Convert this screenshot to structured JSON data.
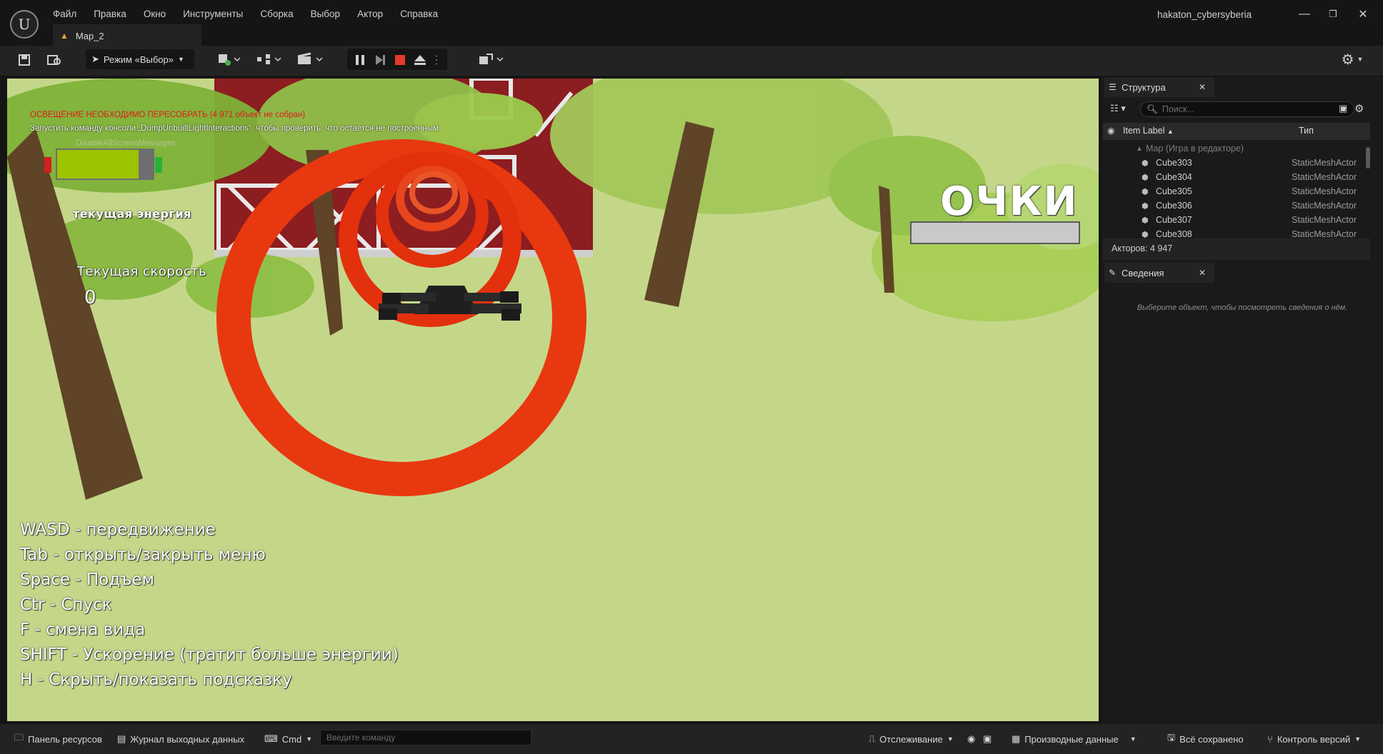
{
  "app": {
    "project_name": "hakaton_cybersyberia",
    "document_tab": "Map_2"
  },
  "menu": [
    "Файл",
    "Правка",
    "Окно",
    "Инструменты",
    "Сборка",
    "Выбор",
    "Актор",
    "Справка"
  ],
  "toolbar": {
    "mode_label": "Режим «Выбор»"
  },
  "viewport": {
    "warning_title": "ОСВЕЩЕНИЕ НЕОБХОДИМО ПЕРЕСОБРАТЬ (4 971 объект не собран)",
    "warning_hint": "Запустить команду консоли „DumpUnbuiltLightInteractions“, чтобы проверить, что остается не построенным",
    "screen_message": "DisableAllScreenMessages",
    "energy_label": "текущая энергия",
    "energy_level": 0.85,
    "speed_label": "Текущая скорость",
    "speed_value": "0",
    "score_label": "ОЧКИ",
    "hints": [
      "WASD - передвижение",
      "Tab - открыть/закрыть меню",
      "Space - Подъем",
      "Ctr - Спуск",
      "F - смена вида",
      "SHIFT - Ускорение (тратит больше энергии)",
      "H - Скрыть/показать подсказку"
    ]
  },
  "outliner": {
    "tab_label": "Структура",
    "search_placeholder": "Поиск...",
    "col_label": "Item Label",
    "col_type": "Тип",
    "map_row": "Map (Игра в редакторе)",
    "rows": [
      {
        "name": "Cube303",
        "type": "StaticMeshActor"
      },
      {
        "name": "Cube304",
        "type": "StaticMeshActor"
      },
      {
        "name": "Cube305",
        "type": "StaticMeshActor"
      },
      {
        "name": "Cube306",
        "type": "StaticMeshActor"
      },
      {
        "name": "Cube307",
        "type": "StaticMeshActor"
      },
      {
        "name": "Cube308",
        "type": "StaticMeshActor"
      }
    ],
    "actor_count": "Акторов: 4 947"
  },
  "details": {
    "tab_label": "Сведения",
    "empty_hint": "Выберите объект, чтобы посмотреть сведения о нём."
  },
  "statusbar": {
    "content_browser": "Панель ресурсов",
    "output_log": "Журнал выходных данных",
    "cmd": "Cmd",
    "cmd_placeholder": "Введите команду",
    "trace": "Отслеживание",
    "derived_data": "Производные данные",
    "all_saved": "Всё сохранено",
    "source_control": "Контроль версий"
  },
  "colors": {
    "accent_ring": "#e8380f",
    "energy_fill": "#9cc400",
    "warning_red": "#e21a1a"
  }
}
